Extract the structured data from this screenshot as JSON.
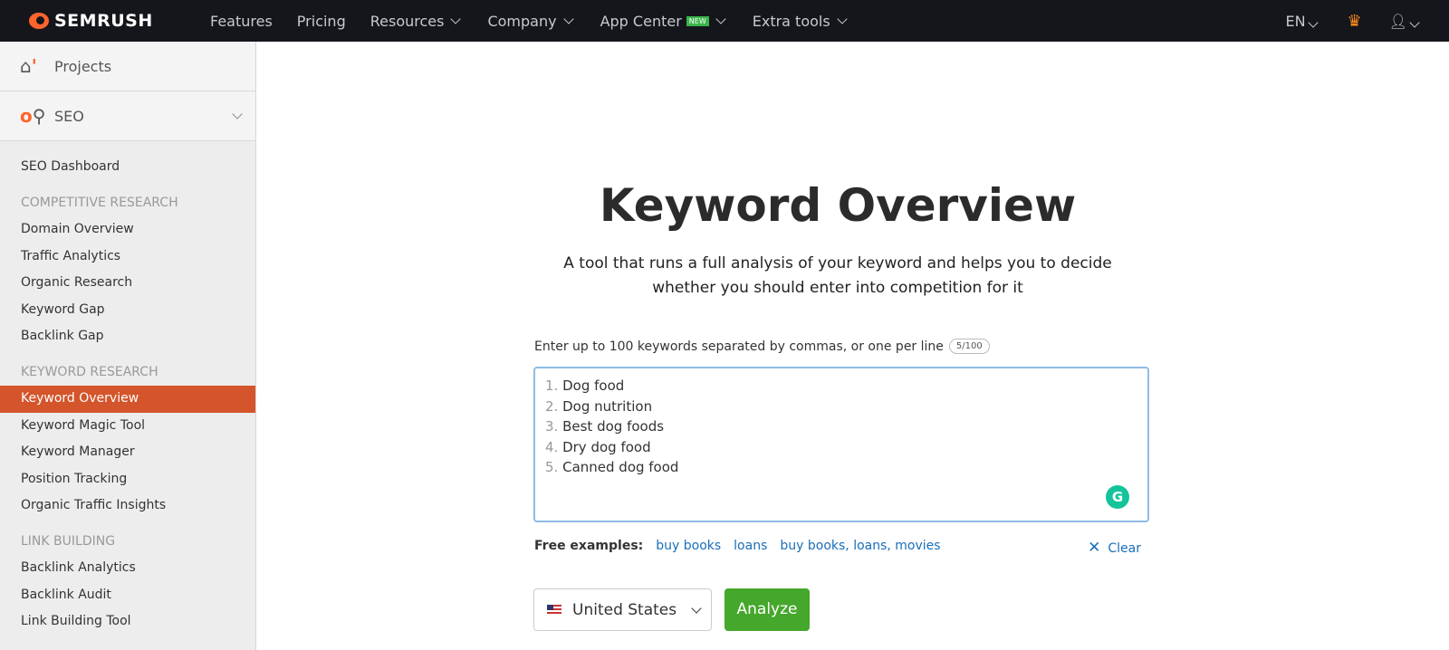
{
  "topbar": {
    "brand": "SEMRUSH",
    "nav": [
      "Features",
      "Pricing",
      "Resources",
      "Company",
      "App Center",
      "Extra tools"
    ],
    "new_badge": "NEW",
    "lang": "EN",
    "accent": "#ff642d"
  },
  "sidebar": {
    "projects": "Projects",
    "seo": "SEO",
    "items": [
      {
        "type": "item",
        "label": "SEO Dashboard"
      },
      {
        "type": "section",
        "label": "COMPETITIVE RESEARCH"
      },
      {
        "type": "item",
        "label": "Domain Overview"
      },
      {
        "type": "item",
        "label": "Traffic Analytics"
      },
      {
        "type": "item",
        "label": "Organic Research"
      },
      {
        "type": "item",
        "label": "Keyword Gap"
      },
      {
        "type": "item",
        "label": "Backlink Gap"
      },
      {
        "type": "section",
        "label": "KEYWORD RESEARCH"
      },
      {
        "type": "item",
        "label": "Keyword Overview",
        "active": true
      },
      {
        "type": "item",
        "label": "Keyword Magic Tool"
      },
      {
        "type": "item",
        "label": "Keyword Manager"
      },
      {
        "type": "item",
        "label": "Position Tracking"
      },
      {
        "type": "item",
        "label": "Organic Traffic Insights"
      },
      {
        "type": "section",
        "label": "LINK BUILDING"
      },
      {
        "type": "item",
        "label": "Backlink Analytics"
      },
      {
        "type": "item",
        "label": "Backlink Audit"
      },
      {
        "type": "item",
        "label": "Link Building Tool"
      }
    ]
  },
  "main": {
    "title": "Keyword Overview",
    "subtitle_1": "A tool that runs a full analysis of your keyword and helps you to decide",
    "subtitle_2": "whether you should enter into competition for it",
    "input_label": "Enter up to 100 keywords separated by commas, or one per line",
    "counter": "5/100",
    "keywords": [
      "Dog food",
      "Dog nutrition",
      "Best dog foods",
      "Dry dog food",
      "Canned dog food"
    ],
    "examples_label": "Free examples:",
    "examples": [
      "buy books",
      "loans",
      "buy books, loans, movies"
    ],
    "clear": "Clear",
    "country": "United States",
    "analyze": "Analyze"
  }
}
